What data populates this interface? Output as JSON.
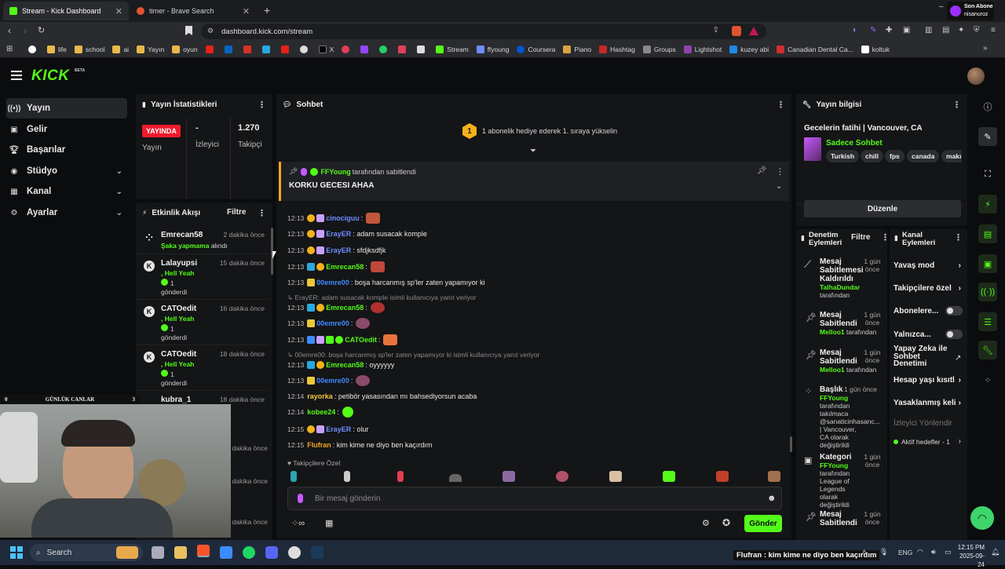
{
  "browser": {
    "tabs": [
      {
        "label": "Stream - Kick Dashboard"
      },
      {
        "label": "timer - Brave Search"
      }
    ],
    "url": "dashboard.kick.com/stream",
    "notif": {
      "line1": "Son Abone",
      "line2": "nisanuroz"
    },
    "bookmarks": [
      "life",
      "school",
      "ai",
      "Yayın",
      "oyun",
      "X",
      "Stream",
      "ffyoung",
      "Coursera",
      "Piano",
      "Hashtag",
      "Groups",
      "Lightshot",
      "kuzey abi",
      "Canadian Dental Ca...",
      "koltuk"
    ]
  },
  "app": {
    "logo": "KICK",
    "logo_badge": "BETA"
  },
  "sidebar": {
    "items": [
      {
        "label": "Yayın",
        "icon": "broadcast-icon"
      },
      {
        "label": "Gelir",
        "icon": "wallet-icon"
      },
      {
        "label": "Başarılar",
        "icon": "trophy-icon"
      },
      {
        "label": "Stüdyo",
        "icon": "studio-icon"
      },
      {
        "label": "Kanal",
        "icon": "channel-icon"
      },
      {
        "label": "Ayarlar",
        "icon": "gear-icon"
      }
    ]
  },
  "stats": {
    "title": "Yayın İstatistikleri",
    "status_badge": "YAYINDA",
    "status_label": "Yayın",
    "viewers_value": "-",
    "viewers_label": "İzleyici",
    "followers_value": "1.270",
    "followers_label": "Takipçi"
  },
  "activity": {
    "title": "Etkinlik Akışı",
    "filter": "Filtre",
    "items": [
      {
        "name": "Emrecan58",
        "time": "2 dakika önce",
        "line1": "Şaka yapmama",
        "line1b": "alındı",
        "line2": ""
      },
      {
        "name": "Lalayupsi",
        "time": "15 dakika önce",
        "line1": ", Hell Yeah",
        "line1b": "1",
        "line2": "gönderdi"
      },
      {
        "name": "CATOedit",
        "time": "16 dakika önce",
        "line1": ", Hell Yeah",
        "line1b": "1",
        "line2": "gönderdi"
      },
      {
        "name": "CATOedit",
        "time": "18 dakika önce",
        "line1": ", Hell Yeah",
        "line1b": "1",
        "line2": "gönderdi"
      },
      {
        "name": "kubra_1",
        "time": "18 dakika önce",
        "line1": "",
        "line1b": "",
        "line2": ""
      }
    ],
    "extra_times": [
      "dakika önce",
      "dakika önce",
      "dakika önce"
    ]
  },
  "overlay": {
    "title": "GÜNLÜK CANLAR",
    "left": "0",
    "right": "3"
  },
  "chat": {
    "title": "Sohbet",
    "goal": "1 abonelik hediye ederek 1. sıraya yükselin",
    "goal_rank": "1",
    "pinned_by": "FFYoung",
    "pinned_suffix": "tarafından sabitlendi",
    "pinned_text": "KORKU GECESI AHAA",
    "messages": [
      {
        "time": "12:13",
        "user": "cinociguu",
        "text": "",
        "color": "#6f8cff"
      },
      {
        "time": "12:13",
        "user": "ErayER",
        "text": "adam susacak komple",
        "color": "#6f8cff"
      },
      {
        "time": "12:13",
        "user": "ErayER",
        "text": "sfdjksdfjk",
        "color": "#6f8cff"
      },
      {
        "time": "12:13",
        "user": "Emrecan58",
        "text": "",
        "color": "#53fc18"
      },
      {
        "time": "12:13",
        "user": "00emre00",
        "text": "boşa harcanmış sp'ler zaten yapamıyor ki",
        "color": "#3d8bff"
      },
      {
        "time": "12:13",
        "user": "Emrecan58",
        "text": "",
        "color": "#53fc18"
      },
      {
        "time": "12:13",
        "user": "00emre00",
        "text": "",
        "color": "#3d8bff"
      },
      {
        "time": "12:13",
        "user": "CATOedit",
        "text": "",
        "color": "#53fc18"
      },
      {
        "time": "12:13",
        "user": "Emrecan58",
        "text": "oyyyyyy",
        "color": "#53fc18"
      },
      {
        "time": "12:13",
        "user": "00emre00",
        "text": "",
        "color": "#3d8bff"
      },
      {
        "time": "12:14",
        "user": "rayorka",
        "text": "petibör yasasından mı bahsediyorsun acaba",
        "color": "#f5c542"
      },
      {
        "time": "12:14",
        "user": "kobee24",
        "text": "",
        "color": "#53fc18"
      },
      {
        "time": "12:15",
        "user": "ErayER",
        "text": "olur",
        "color": "#6f8cff"
      },
      {
        "time": "12:15",
        "user": "Flufran",
        "text": "kim kime ne diyo ben kaçırdım",
        "color": "#f5a623"
      }
    ],
    "replies": [
      "ErayER: adam susacak komple isimli kullanıcıya yanıt veriyor",
      "00emre00: boşa harcanmış sp'ler zaten yapamıyor ki isimli kullanıcıya yanıt veriyor"
    ],
    "followers_special": "Takipçilere Özel",
    "input_placeholder": "Bir mesaj gönderin",
    "send": "Gönder"
  },
  "stream_info": {
    "title": "Yayın bilgisi",
    "stream_title": "Gecelerin fatihi | Vancouver, CA",
    "category": "Sadece Sohbet",
    "tags": [
      "Turkish",
      "chill",
      "fps",
      "canada",
      "makı"
    ],
    "edit": "Düzenle"
  },
  "mod_actions": {
    "title": "Denetim Eylemleri",
    "filter": "Filtre",
    "items": [
      {
        "title": "Mesaj Sabitlemesi Kaldırıldı",
        "user": "TalhaDundar",
        "suffix": "tarafından",
        "time": "1 gün önce"
      },
      {
        "title": "Mesaj Sabitlendi",
        "user": "Melloo1",
        "suffix": "tarafından",
        "time": "1 gün önce"
      },
      {
        "title": "Mesaj Sabitlendi",
        "user": "Melloo1",
        "suffix": "tarafından",
        "time": "1 gün önce"
      },
      {
        "title": "Başlık",
        "user": "FFYoung",
        "suffix": "tarafından takılmaca @sanaticinhasanc... | Vancouver, CA olarak değiştirildi",
        "time": "1 gün önce"
      },
      {
        "title": "Kategori",
        "user": "FFYoung",
        "suffix": "tarafından League of Legends olarak değiştirildi",
        "time": "1 gün önce"
      },
      {
        "title": "Mesaj Sabitlendi",
        "user": "",
        "suffix": "",
        "time": "1 gün önce"
      }
    ]
  },
  "channel_actions": {
    "title": "Kanal Eylemleri",
    "items": [
      "Yavaş mod",
      "Takipçilere özel",
      "Abonelere...",
      "Yalnızca...",
      "Yapay Zeka ile Sohbet Denetimi",
      "Hesap yaşı kısıtl",
      "Yasaklanmış keli",
      "İzleyici Yönlendir"
    ],
    "goals": "Aktif hedefler - 1"
  },
  "taskbar": {
    "search": "Search",
    "ticker": "Flufran : kim kime ne diyo ben kaçırdım",
    "lang": "ENG",
    "time": "12:15 PM",
    "date": "2025-09-24"
  },
  "colors": {
    "brand": "#53fc18",
    "live": "#ee1b2c",
    "panel": "#141517"
  }
}
